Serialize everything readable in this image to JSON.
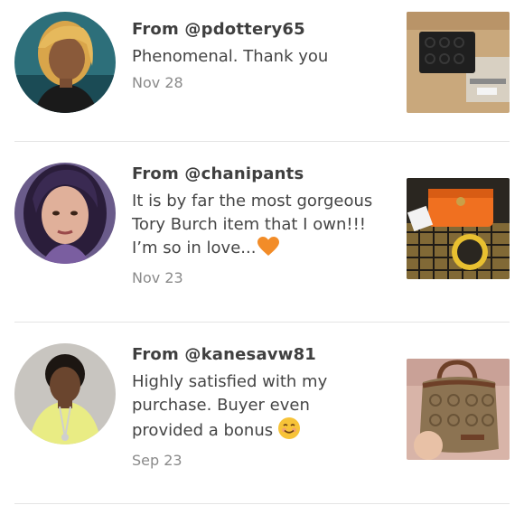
{
  "reviews": [
    {
      "handle": "From @pdottery65",
      "comment": "Phenomenal. Thank you",
      "date": "Nov 28",
      "avatar_icon": "reviewer-avatar",
      "thumbnail_icon": "black-coach-wallet"
    },
    {
      "handle": "From @chanipants",
      "comment_lines": [
        "It is by far the most gorgeous",
        "Tory Burch item that I own!!!",
        "I’m so in love..."
      ],
      "comment_emoji": "orange-heart-emoji",
      "date": "Nov 23",
      "avatar_icon": "reviewer-avatar",
      "thumbnail_icon": "orange-tory-burch-wristlet"
    },
    {
      "handle": "From @kanesavw81",
      "comment_lines": [
        "Highly satisfied with my",
        "purchase. Buyer even",
        "provided a bonus"
      ],
      "comment_emoji": "smiling-face-emoji",
      "date": "Sep 23",
      "avatar_icon": "reviewer-avatar",
      "thumbnail_icon": "brown-coach-bag"
    }
  ],
  "colors": {
    "handle": "#3f3f3f",
    "comment": "#454545",
    "date": "#8a8a8a",
    "divider": "#e4e4e4"
  }
}
